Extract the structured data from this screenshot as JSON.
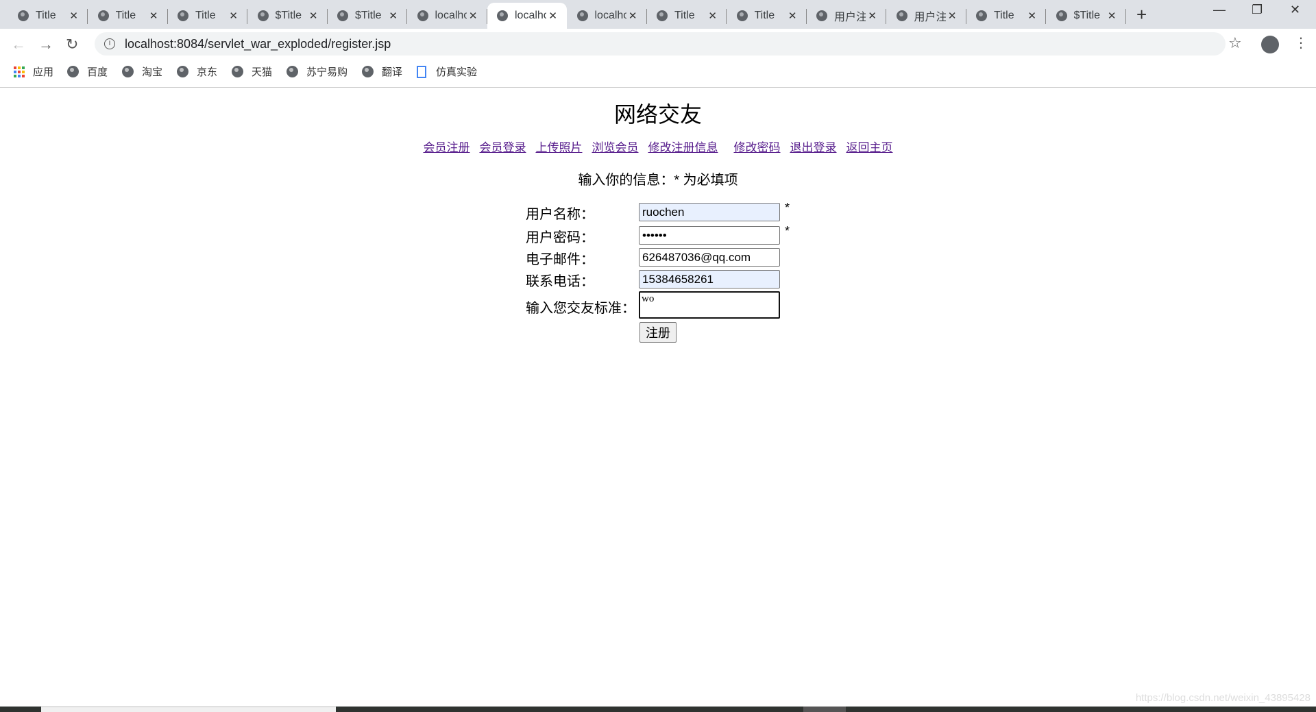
{
  "browser": {
    "tabs": [
      {
        "label": "Title"
      },
      {
        "label": "Title"
      },
      {
        "label": "Title"
      },
      {
        "label": "$Title"
      },
      {
        "label": "$Title"
      },
      {
        "label": "localhost"
      },
      {
        "label": "localhost",
        "active": true
      },
      {
        "label": "localhost"
      },
      {
        "label": "Title"
      },
      {
        "label": "Title"
      },
      {
        "label": "用户注"
      },
      {
        "label": "用户注"
      },
      {
        "label": "Title"
      },
      {
        "label": "$Title"
      }
    ],
    "url": "localhost:8084/servlet_war_exploded/register.jsp",
    "bookmarks": [
      {
        "label": "应用",
        "icon": "apps-icon"
      },
      {
        "label": "百度",
        "icon": "globe-icon"
      },
      {
        "label": "淘宝",
        "icon": "globe-icon"
      },
      {
        "label": "京东",
        "icon": "globe-icon"
      },
      {
        "label": "天猫",
        "icon": "globe-icon"
      },
      {
        "label": "苏宁易购",
        "icon": "globe-icon"
      },
      {
        "label": "翻译",
        "icon": "globe-icon"
      },
      {
        "label": "仿真实验",
        "icon": "document-icon"
      }
    ]
  },
  "page": {
    "title": "网络交友",
    "nav_links": [
      "会员注册",
      "会员登录",
      "上传照片",
      "浏览会员",
      "修改注册信息",
      "修改密码",
      "退出登录",
      "返回主页"
    ],
    "subtitle": "输入你的信息：* 为必填项",
    "form": {
      "username_label": "用户名称：",
      "username_value": "ruochen",
      "password_label": "用户密码：",
      "password_value": "••••••",
      "email_label": "电子邮件：",
      "email_value": "626487036@qq.com",
      "phone_label": "联系电话：",
      "phone_value": "15384658261",
      "criteria_label": "输入您交友标准：",
      "criteria_value": "wo",
      "required_mark": "*",
      "submit_label": "注册"
    }
  },
  "watermark": "https://blog.csdn.net/weixin_43895428"
}
